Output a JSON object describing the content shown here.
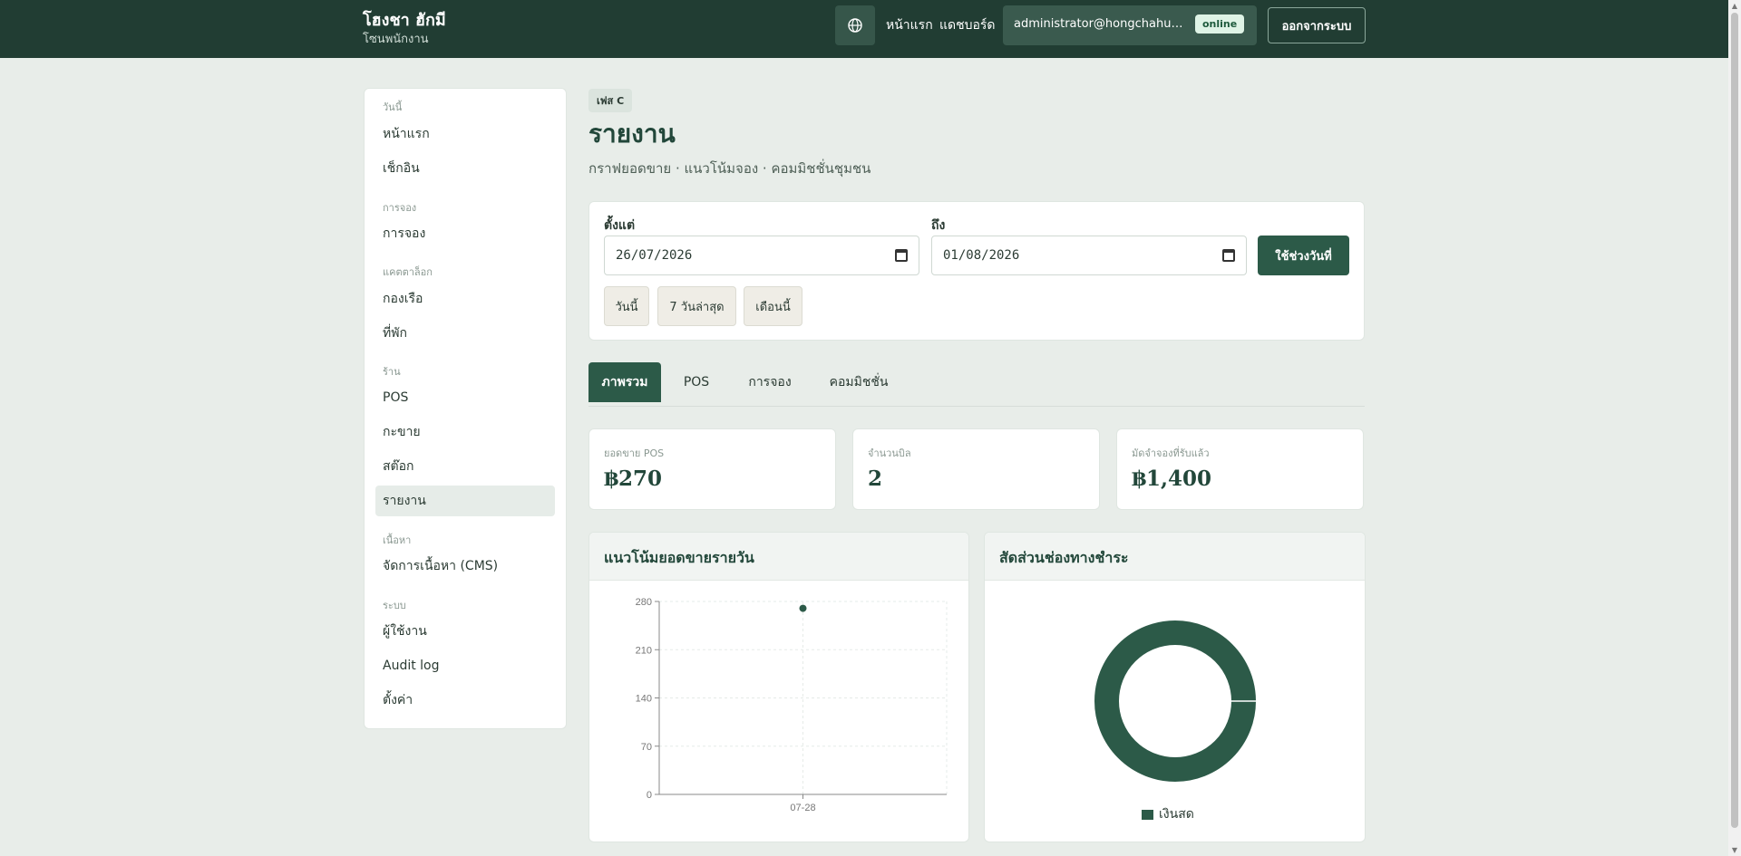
{
  "brand": {
    "title": "โฮงชา ฮักมี",
    "subtitle": "โซนพนักงาน"
  },
  "topnav": {
    "globe_icon": "globe-icon",
    "links": [
      "หน้าแรก",
      "แดชบอร์ด"
    ],
    "user_email": "administrator@hongchahug...",
    "status": "online",
    "logout": "ออกจากระบบ"
  },
  "sidebar": {
    "groups": [
      {
        "label": "วันนี้",
        "items": [
          "หน้าแรก",
          "เช็กอิน"
        ]
      },
      {
        "label": "การจอง",
        "items": [
          "การจอง"
        ]
      },
      {
        "label": "แคตตาล็อก",
        "items": [
          "กองเรือ",
          "ที่พัก"
        ]
      },
      {
        "label": "ร้าน",
        "items": [
          "POS",
          "กะขาย",
          "สต๊อก",
          "รายงาน"
        ]
      },
      {
        "label": "เนื้อหา",
        "items": [
          "จัดการเนื้อหา (CMS)"
        ]
      },
      {
        "label": "ระบบ",
        "items": [
          "ผู้ใช้งาน",
          "Audit log",
          "ตั้งค่า"
        ]
      }
    ],
    "active": "รายงาน"
  },
  "page": {
    "badge": "เฟส C",
    "title": "รายงาน",
    "subtitle": "กราฟยอดขาย · แนวโน้มจอง · คอมมิชชั่นชุมชน"
  },
  "filter": {
    "from_label": "ตั้งแต่",
    "from_value": "26/07/2026",
    "to_label": "ถึง",
    "to_value": "01/08/2026",
    "apply": "ใช้ช่วงวันที่",
    "quick": [
      "วันนี้",
      "7 วันล่าสุด",
      "เดือนนี้"
    ]
  },
  "tabs": {
    "items": [
      "ภาพรวม",
      "POS",
      "การจอง",
      "คอมมิชชั่น"
    ],
    "active": "ภาพรวม"
  },
  "stats": [
    {
      "label": "ยอดขาย POS",
      "value": "฿270"
    },
    {
      "label": "จำนวนบิล",
      "value": "2"
    },
    {
      "label": "มัดจำจองที่รับแล้ว",
      "value": "฿1,400"
    }
  ],
  "panels": {
    "trend_title": "แนวโน้มยอดขายรายวัน",
    "share_title": "สัดส่วนช่องทางชำระ"
  },
  "colors": {
    "primary": "#2c5a48",
    "topbar": "#213d33",
    "background": "#e8ede9"
  },
  "chart_data": [
    {
      "type": "scatter",
      "x": [
        "07-28"
      ],
      "series": [
        {
          "values": [
            270
          ]
        }
      ],
      "ylim": [
        0,
        280
      ],
      "yticks": [
        0,
        70,
        140,
        210,
        280
      ],
      "grid": true,
      "title": "",
      "xlabel": "",
      "ylabel": ""
    },
    {
      "type": "pie",
      "donut": true,
      "labels": [
        "เงินสด"
      ],
      "values": [
        100
      ],
      "legend": "bottom",
      "title": ""
    }
  ]
}
